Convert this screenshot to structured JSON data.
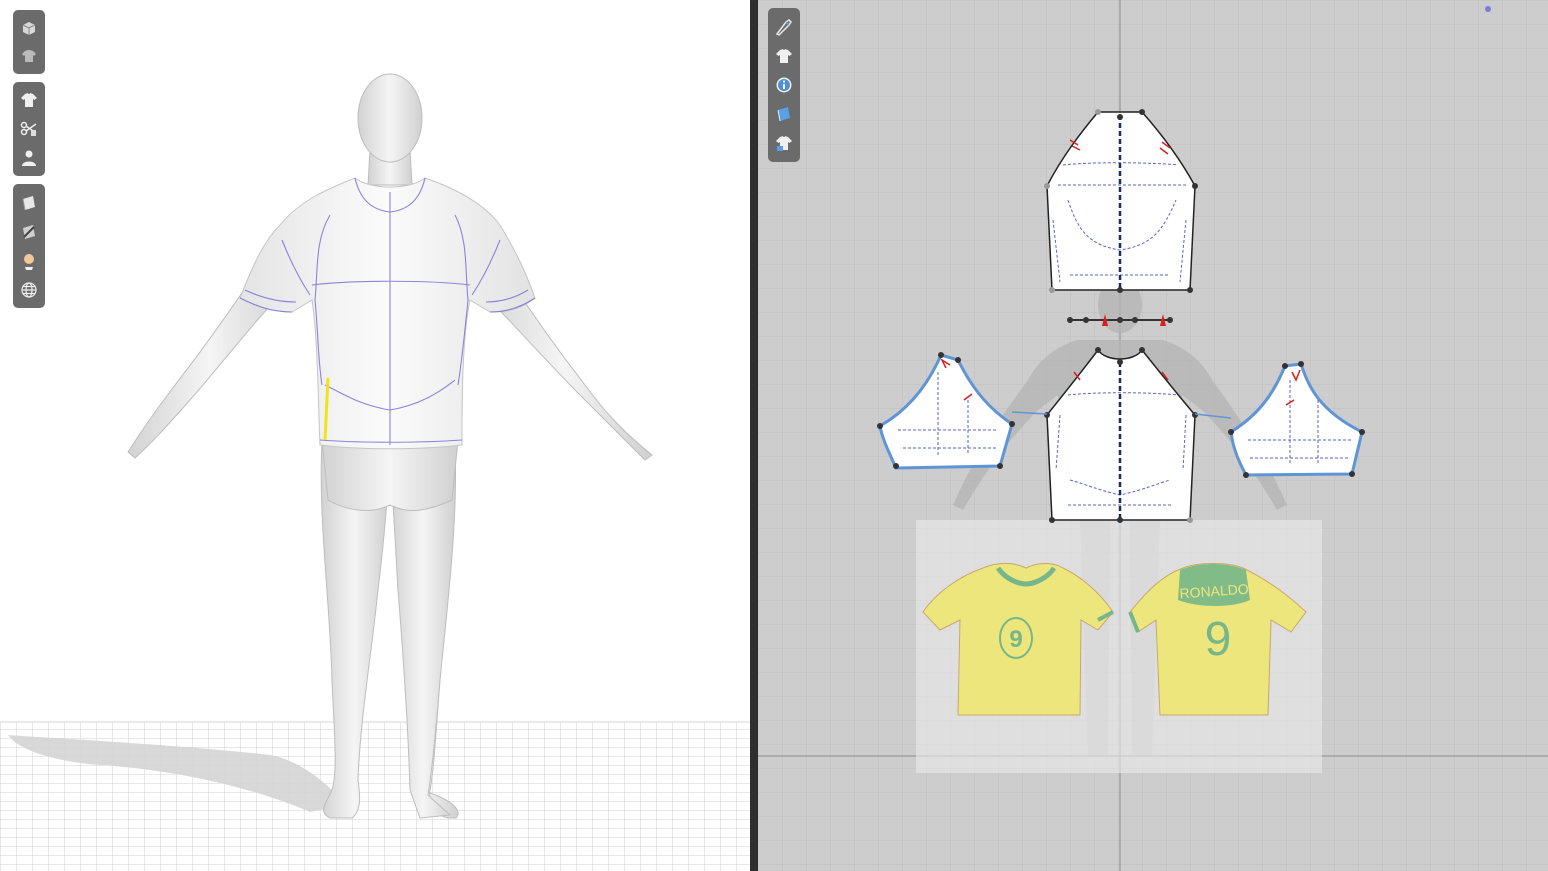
{
  "app": {
    "panels": [
      "3d-view",
      "2d-pattern-view"
    ]
  },
  "toolbar_3d": {
    "groups": [
      [
        {
          "icon": "avatar-box-icon"
        },
        {
          "icon": "garment-hanger-icon"
        }
      ],
      [
        {
          "icon": "tshirt-icon"
        },
        {
          "icon": "sewing-tools-icon"
        },
        {
          "icon": "avatar-person-icon"
        }
      ],
      [
        {
          "icon": "fabric-sheet-icon"
        },
        {
          "icon": "fabric-texture-icon"
        },
        {
          "icon": "light-icon"
        },
        {
          "icon": "globe-icon"
        }
      ]
    ]
  },
  "toolbar_2d": {
    "items": [
      {
        "icon": "pen-icon"
      },
      {
        "icon": "tshirt-icon"
      },
      {
        "icon": "info-icon"
      },
      {
        "icon": "fabric-sheet-icon"
      },
      {
        "icon": "tshirt-settings-icon"
      }
    ]
  },
  "reference_image": {
    "player_name": "RONALDO",
    "front_number": "9",
    "back_number": "9"
  },
  "colors": {
    "panel_3d_bg": "#ffffff",
    "panel_2d_bg": "#cdcdcd",
    "toolbar_bg": "#6b6b6b",
    "seam_line": "#7a72d6",
    "selected_edge": "#5f95d6",
    "notch": "#d62020",
    "highlight_edge": "#f2e21a",
    "jersey_yellow": "#ece67c",
    "jersey_green": "#76b68a"
  }
}
